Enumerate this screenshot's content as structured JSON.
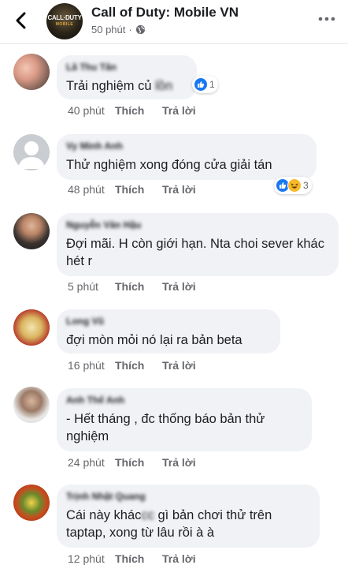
{
  "header": {
    "title": "Call of Duty: Mobile VN",
    "time": "50 phút",
    "separator": "·",
    "logo_text": "CALL·DUTY",
    "logo_sub": "MOBILE"
  },
  "action_labels": {
    "like": "Thích",
    "reply": "Trả lời"
  },
  "comments": [
    {
      "author": "Lã Thu Tân",
      "text": "Trải nghiệm củ",
      "text_suffix": "lồn",
      "time": "40 phút",
      "reaction_count": "1"
    },
    {
      "author": "Vy Minh Anh",
      "text": "Thử nghiệm xong đóng cửa giải tán",
      "time": "48 phút",
      "reaction_count": "3"
    },
    {
      "author": "Nguyễn Văn Hậu",
      "text": "Đợi mãi. H còn giới hạn. Nta choi sever khác hét r",
      "time": "5 phút"
    },
    {
      "author": "Long Vũ",
      "text": "đợi mòn mỏi nó lại ra bản beta",
      "time": "16 phút"
    },
    {
      "author": "Anh Thế Anh",
      "text": "- Hết tháng , đc thống báo bản thử nghiệm",
      "time": "24 phút"
    },
    {
      "author": "Trịnh Nhật Quang",
      "text_prefix": "Cái này khác",
      "text_censor": "cc",
      "text": "gì bản chơi thử trên taptap, xong từ lâu rồi à à",
      "time": "12 phút"
    }
  ],
  "colors": {
    "bubble": "#f0f2f5",
    "meta": "#65676b",
    "like_blue": "#1877f2",
    "haha_yellow": "#f7b928"
  },
  "icons": [
    "back-arrow-icon",
    "globe-icon",
    "more-dots-icon",
    "like-reaction-icon",
    "haha-reaction-icon"
  ]
}
